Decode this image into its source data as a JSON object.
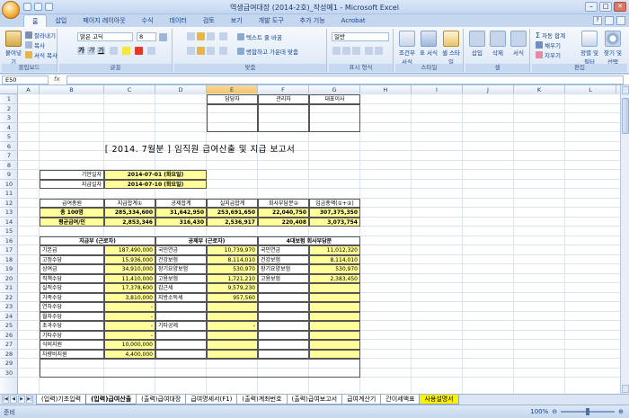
{
  "window": {
    "title": "역생급여대장 (2014-2호)_작성예1 - Microsoft Excel"
  },
  "ribbon": {
    "tabs": [
      "홈",
      "삽입",
      "페이지 레이아웃",
      "수식",
      "데이터",
      "검토",
      "보기",
      "개발 도구",
      "추가 기능",
      "Acrobat"
    ],
    "clipboard": {
      "paste": "붙여넣기",
      "cut": "잘라내기",
      "copy": "복사",
      "format_painter": "서식 복사",
      "label": "클립보드"
    },
    "font": {
      "name": "맑은 고딕",
      "size": "8",
      "label": "글꼴"
    },
    "align": {
      "wrap": "텍스트 줄 바꿈",
      "merge": "병합하고 가운데 맞춤",
      "label": "맞춤"
    },
    "number": {
      "format": "일반",
      "label": "표시 형식"
    },
    "styles": {
      "cond": "조건부 서식",
      "table": "표 서식",
      "cell": "셀 스타일",
      "label": "스타일"
    },
    "cells": {
      "insert": "삽입",
      "delete": "삭제",
      "format": "서식",
      "label": "셀"
    },
    "edit": {
      "autosum": "자동 합계",
      "fill": "채우기",
      "clear": "지우기",
      "sort": "정렬 및 필터",
      "find": "찾기 및 선택",
      "label": "편집"
    }
  },
  "formula": {
    "namebox": "E50",
    "fx": "fx"
  },
  "columns": [
    "A",
    "B",
    "C",
    "D",
    "E",
    "F",
    "G",
    "H",
    "I",
    "J",
    "K",
    "L"
  ],
  "rows": [
    "1",
    "2",
    "3",
    "4",
    "5",
    "6",
    "7",
    "8",
    "9",
    "10",
    "11",
    "12",
    "13",
    "14",
    "15",
    "16",
    "17",
    "18",
    "19",
    "20",
    "21",
    "22",
    "23",
    "24",
    "25",
    "26",
    "27",
    "28",
    "29",
    "30"
  ],
  "approval": [
    "담당자",
    "관리자",
    "대표이사"
  ],
  "report_title": "[ 2014. 7월분 ]  임직원 급여산출 및 지급 보고서",
  "period": {
    "l1": "기안일자",
    "v1": "2014-07-01 (화요일)",
    "l2": "지급일자",
    "v2": "2014-07-10 (화요일)"
  },
  "summary": {
    "headers": [
      "급여총원",
      "지급합계①",
      "공제합계",
      "실지급합계",
      "회사부담분②",
      "임금총액(①+②)"
    ],
    "row1": [
      "총 100명",
      "285,334,600",
      "31,642,950",
      "253,691,650",
      "22,040,750",
      "307,375,350"
    ],
    "row2": [
      "평균급여/인",
      "2,853,346",
      "316,430",
      "2,536,917",
      "220,408",
      "3,073,754"
    ]
  },
  "detail": {
    "h_pay": "지급부 (근로자)",
    "h_ded": "공제부 (근로자)",
    "h_comp": "4대보험 회사부담분",
    "pay_items": [
      "기본급",
      "고정수당",
      "상여금",
      "직책수당",
      "실적수당",
      "가족수당",
      "연차수당",
      "월차수당",
      "초과수당",
      "기타수당",
      "식비지원",
      "차량비지원"
    ],
    "pay_vals": [
      "187,490,000",
      "15,936,000",
      "34,910,000",
      "11,410,000",
      "17,378,600",
      "3,810,000",
      "-",
      "-",
      "-",
      "-",
      "10,000,000",
      "4,400,000"
    ],
    "ded_items": [
      "국민연금",
      "건강보험",
      "장기요양보험",
      "고용보험",
      "갑근세",
      "지방소득세",
      "",
      "",
      "기타공제",
      "",
      "",
      ""
    ],
    "ded_vals": [
      "10,739,970",
      "8,114,010",
      "530,970",
      "1,721,210",
      "9,579,230",
      "957,560",
      "",
      "",
      "-",
      "",
      "",
      ""
    ],
    "comp_items": [
      "국민연금",
      "건강보험",
      "장기요양보험",
      "고용보험"
    ],
    "comp_vals": [
      "11,012,320",
      "8,114,010",
      "530,970",
      "2,383,450"
    ]
  },
  "sheets": [
    "(입력)기초입력",
    "(입력)급여산출",
    "(출력)급여대장",
    "급여명세서(F1)",
    "(출력)계좌번호",
    "(출력)급여보고서",
    "급여계산기",
    "간이세액표",
    "사용설명서"
  ],
  "status": {
    "ready": "준비",
    "zoom": "100%"
  }
}
